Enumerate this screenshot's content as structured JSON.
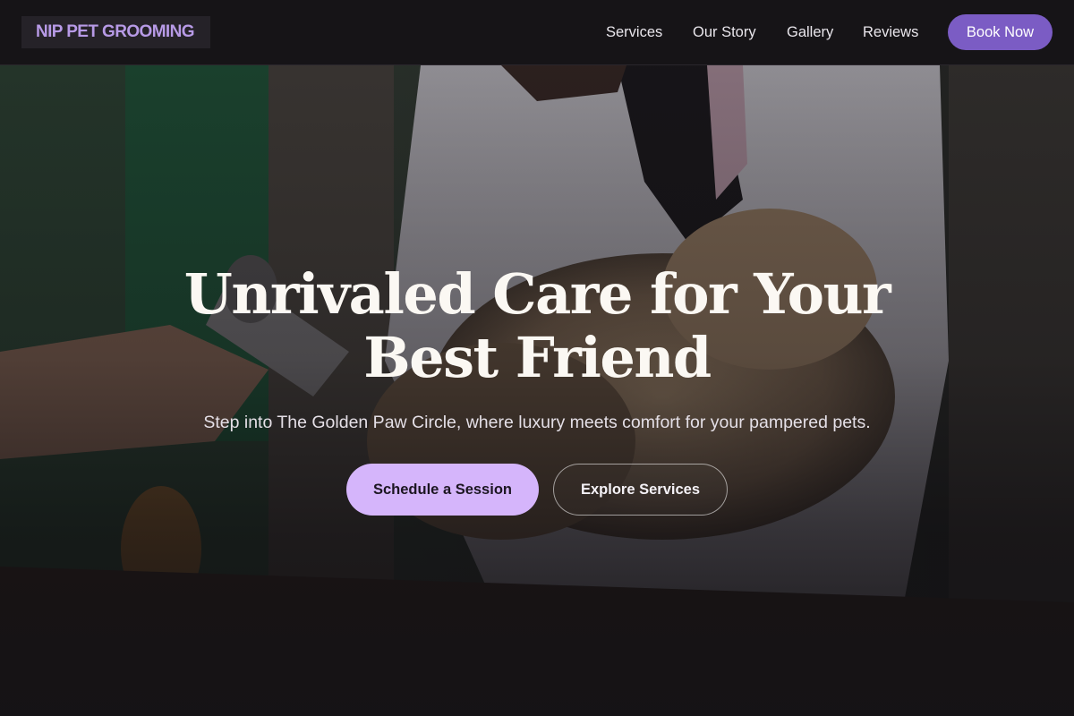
{
  "header": {
    "logo": "NIP PET GROOMING",
    "nav": [
      "Services",
      "Our Story",
      "Gallery",
      "Reviews"
    ],
    "cta": "Book Now"
  },
  "hero": {
    "title_line1": "Unrivaled Care for Your",
    "title_line2": "Best Friend",
    "subtitle": "Step into The Golden Paw Circle, where luxury meets comfort for your pampered pets.",
    "primary_button": "Schedule a Session",
    "secondary_button": "Explore Services"
  },
  "colors": {
    "accent": "#7b5cc4",
    "logo": "#b79ae6",
    "primary_button": "#d5b5fb",
    "header_bg": "#161417"
  }
}
